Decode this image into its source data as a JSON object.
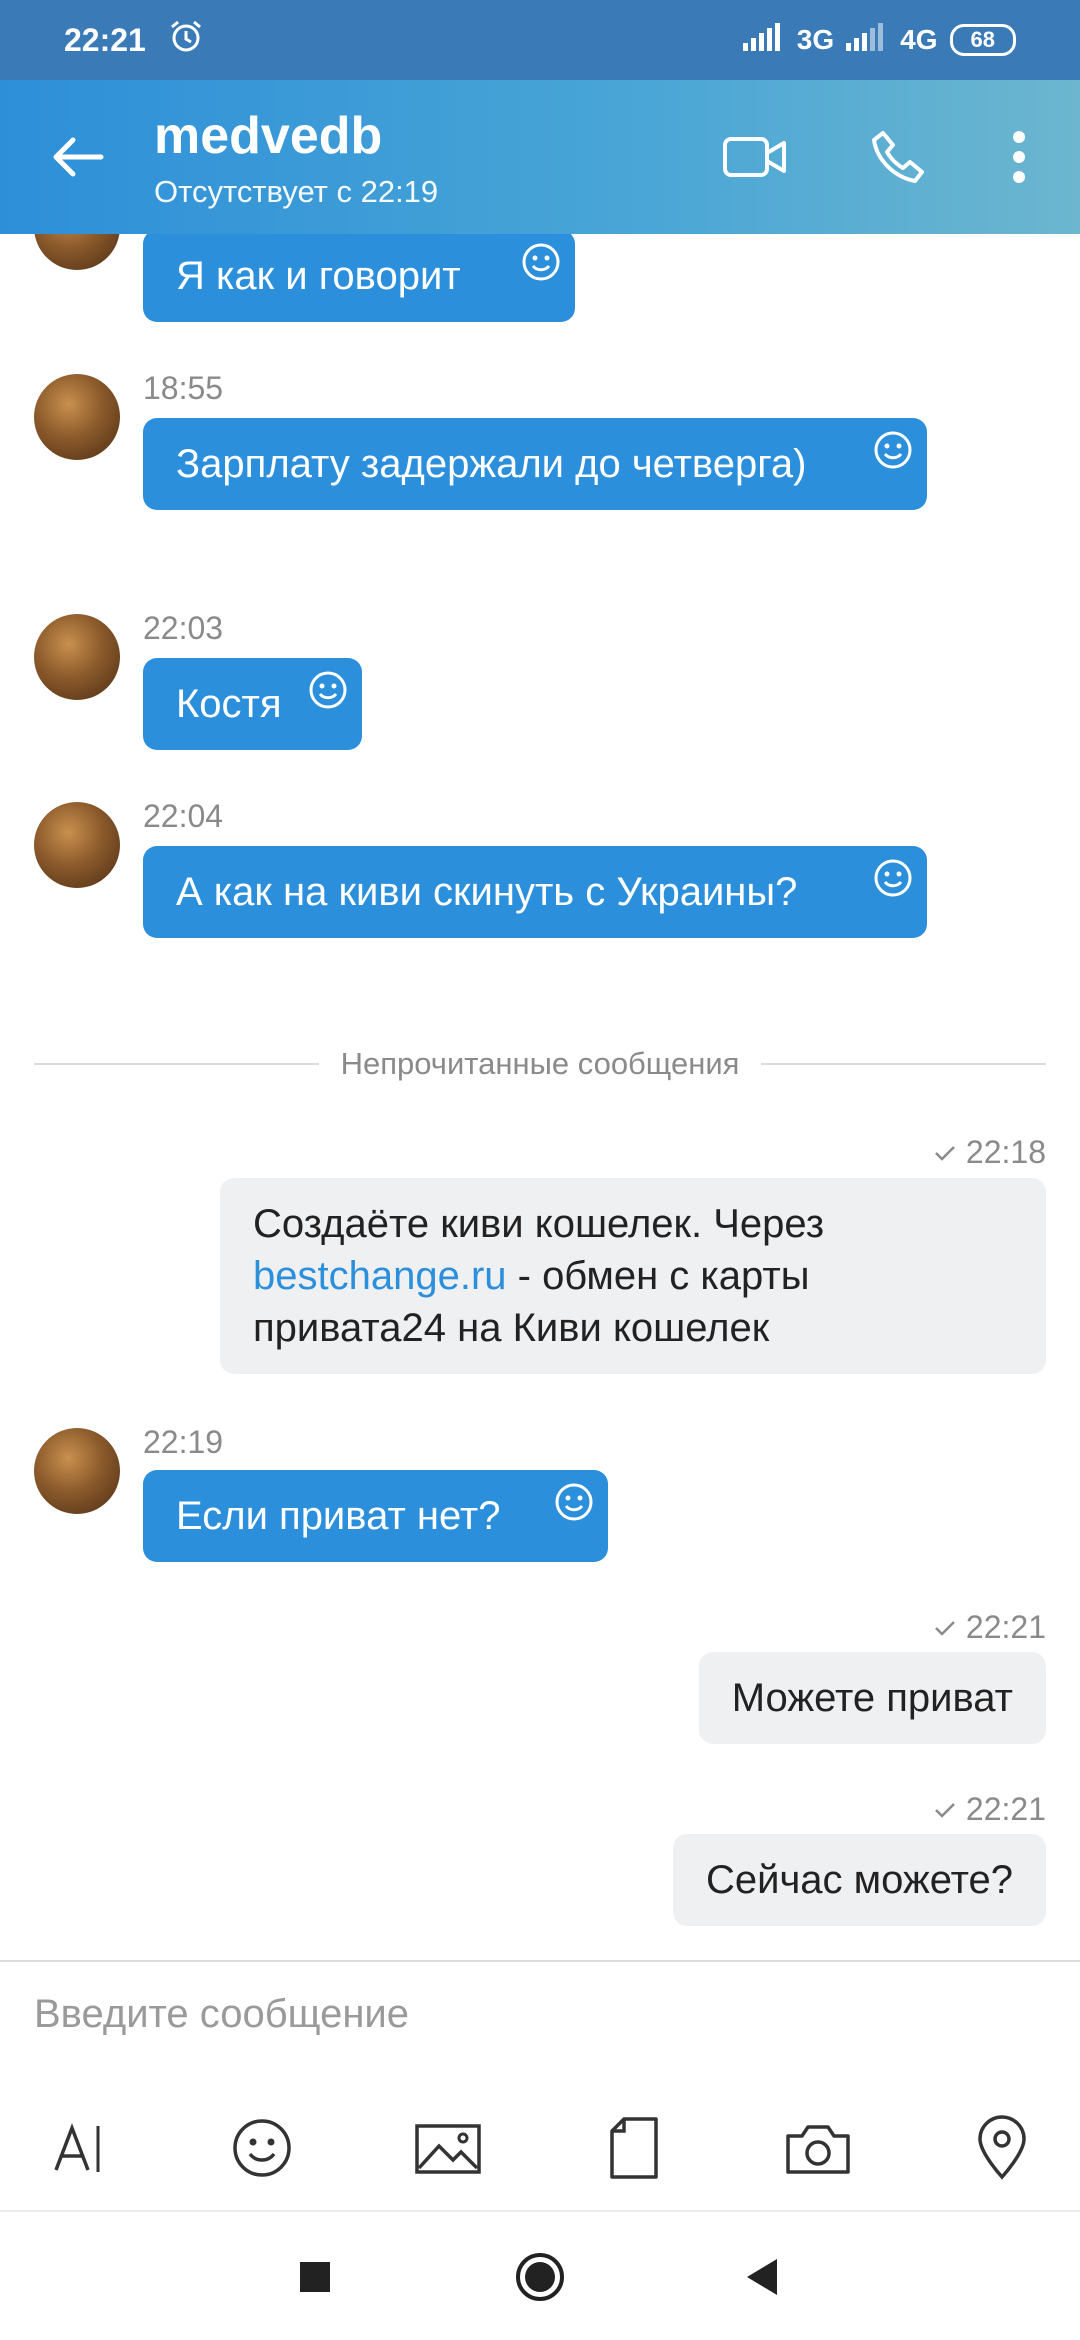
{
  "status_bar": {
    "time": "22:21",
    "network_1": "3G",
    "network_2": "4G",
    "battery": "68"
  },
  "header": {
    "title": "medvedb",
    "subtitle": "Отсутствует с 22:19",
    "icons": [
      "back-arrow-icon",
      "video-call-icon",
      "phone-icon",
      "more-vert-icon"
    ]
  },
  "messages": {
    "m1": {
      "text": "Я как и говорит"
    },
    "m2": {
      "time": "18:55",
      "text": "Зарплату задержали до четверга)"
    },
    "m3": {
      "time": "22:03",
      "text": "Костя"
    },
    "m4": {
      "time": "22:04",
      "text": "А как на киви скинуть с Украины?"
    },
    "unread_label": "Непрочитанные сообщения",
    "m5": {
      "time": "22:18",
      "text_before": "Создаёте киви кошелек. Через",
      "link": "bestchange.ru",
      "text_after": " -  обмен с карты привата24 на Киви кошелек"
    },
    "m6": {
      "time": "22:19",
      "text": "Если приват нет?"
    },
    "m7": {
      "time": "22:21",
      "text": "Можете приват"
    },
    "m8": {
      "time": "22:21",
      "text": "Сейчас можете?"
    }
  },
  "composer": {
    "placeholder": "Введите сообщение",
    "tools": [
      "text-format-icon",
      "emoji-icon",
      "image-icon",
      "file-icon",
      "camera-icon",
      "location-icon"
    ]
  },
  "nav": [
    "recents-icon",
    "home-icon",
    "back-icon"
  ],
  "colors": {
    "header": "#2d8fd8",
    "incoming_bubble": "#2b8fdc",
    "outgoing_bubble": "#eff0f2",
    "link": "#2b8fdc"
  }
}
